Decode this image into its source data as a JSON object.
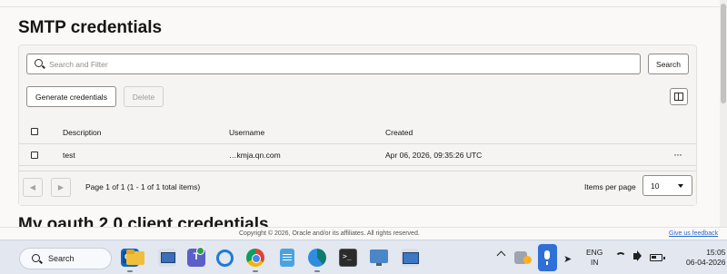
{
  "page": {
    "title": "SMTP credentials",
    "next_section_title": "My oauth 2.0 client credentials"
  },
  "toolbar": {
    "search_placeholder": "Search and Filter",
    "search_button": "Search",
    "generate_button": "Generate credentials",
    "delete_button": "Delete",
    "columns_icon": "columns-icon"
  },
  "table": {
    "columns": [
      "Description",
      "Username",
      "Created"
    ],
    "rows": [
      {
        "description": "test",
        "username": "…kmja.qn.com",
        "created": "Apr 06, 2026, 09:35:26 UTC",
        "actions": "···"
      }
    ]
  },
  "pagination": {
    "info": "Page 1 of 1 (1 - 1 of 1 total items)",
    "items_per_page_label": "Items per page",
    "items_per_page_value": "10"
  },
  "footer": {
    "copyright": "Copyright © 2026, Oracle and/or its affiliates. All rights reserved.",
    "feedback_link": "Give us feedback"
  },
  "taskbar": {
    "search_label": "Search",
    "apps": [
      "outlook-icon",
      "file-explorer-icon",
      "network-icon",
      "teams-icon",
      "edge-gateway-icon",
      "chrome-icon",
      "notepad-icon",
      "edge-icon",
      "terminal-icon",
      "monitor-icon",
      "remote-desktop-icon"
    ],
    "language_line1": "ENG",
    "language_line2": "IN",
    "time": "15:05",
    "date": "06-04-2026"
  },
  "colors": {
    "accent_link": "#2c6ad3",
    "mic_active": "#2f6fd6"
  }
}
